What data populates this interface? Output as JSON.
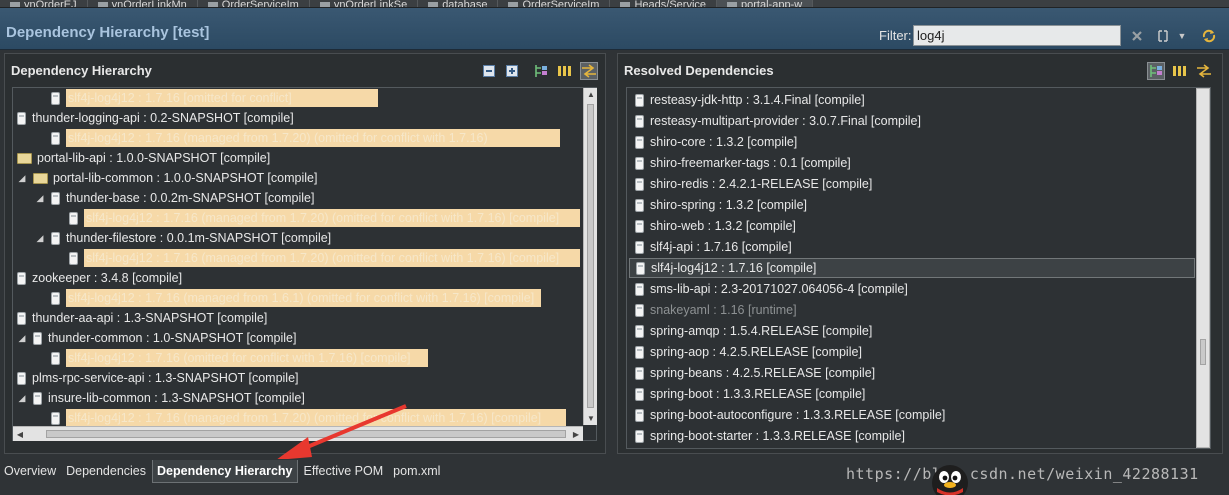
{
  "top_tabs": [
    "ynOrderEJ",
    "ynOrderLinkMn",
    "OrderServiceIm",
    "ynOrderLinkSe",
    "database",
    "OrderServiceIm",
    "Heads/Service",
    "portal-app-w"
  ],
  "header": {
    "title": "Dependency Hierarchy [test]",
    "filter_label": "Filter:",
    "filter_value": "log4j"
  },
  "left_panel": {
    "title": "Dependency Hierarchy",
    "rows": [
      {
        "indent": 1,
        "arrow": "",
        "icon": "jar",
        "label": "",
        "highlight": "slf4j-log4j12 : 1.7.16 [omitted for conflict]"
      },
      {
        "indent": 0,
        "arrow": "",
        "icon": "jar",
        "label": "thunder-logging-api : 0.2-SNAPSHOT [compile]",
        "highlight": ""
      },
      {
        "indent": 1,
        "arrow": "",
        "icon": "jar",
        "label": "",
        "highlight": "slf4j-log4j12 : 1.7.16 (managed from 1.7.20) (omitted for conflict with 1.7.16)"
      },
      {
        "indent": 0,
        "arrow": "",
        "icon": "folder",
        "label": "portal-lib-api : 1.0.0-SNAPSHOT [compile]",
        "highlight": ""
      },
      {
        "indent": 0,
        "arrow": "◢",
        "icon": "folder",
        "label": "portal-lib-common : 1.0.0-SNAPSHOT [compile]",
        "highlight": ""
      },
      {
        "indent": 1,
        "arrow": "◢",
        "icon": "jar",
        "label": "thunder-base : 0.0.2m-SNAPSHOT [compile]",
        "highlight": ""
      },
      {
        "indent": 2,
        "arrow": "",
        "icon": "jar",
        "label": "",
        "highlight": "slf4j-log4j12 : 1.7.16 (managed from 1.7.20) (omitted for conflict with 1.7.16) [compile]"
      },
      {
        "indent": 1,
        "arrow": "◢",
        "icon": "jar",
        "label": "thunder-filestore : 0.0.1m-SNAPSHOT [compile]",
        "highlight": ""
      },
      {
        "indent": 2,
        "arrow": "",
        "icon": "jar",
        "label": "",
        "highlight": "slf4j-log4j12 : 1.7.16 (managed from 1.7.20) (omitted for conflict with 1.7.16) [compile]"
      },
      {
        "indent": 0,
        "arrow": "",
        "icon": "jar",
        "label": "zookeeper : 3.4.8 [compile]",
        "highlight": ""
      },
      {
        "indent": 1,
        "arrow": "",
        "icon": "jar",
        "label": "",
        "highlight": "slf4j-log4j12 : 1.7.16 (managed from 1.6.1) (omitted for conflict with 1.7.16) [compile]"
      },
      {
        "indent": 0,
        "arrow": "",
        "icon": "jar",
        "label": "thunder-aa-api : 1.3-SNAPSHOT [compile]",
        "highlight": ""
      },
      {
        "indent": 0,
        "arrow": "◢",
        "icon": "jar",
        "label": "thunder-common : 1.0-SNAPSHOT [compile]",
        "highlight": ""
      },
      {
        "indent": 1,
        "arrow": "",
        "icon": "jar",
        "label": "",
        "highlight": "slf4j-log4j12 : 1.7.16 (omitted for conflict with 1.7.16) [compile]"
      },
      {
        "indent": 0,
        "arrow": "",
        "icon": "jar",
        "label": "plms-rpc-service-api : 1.3-SNAPSHOT [compile]",
        "highlight": ""
      },
      {
        "indent": 0,
        "arrow": "◢",
        "icon": "jar",
        "label": "insure-lib-common : 1.3-SNAPSHOT [compile]",
        "highlight": ""
      },
      {
        "indent": 1,
        "arrow": "",
        "icon": "jar",
        "label": "",
        "highlight": "slf4j-log4j12 : 1.7.16 (managed from 1.7.20) (omitted for conflict with 1.7.16) [compile]"
      }
    ]
  },
  "right_panel": {
    "title": "Resolved Dependencies",
    "rows": [
      "resteasy-jdk-http : 3.1.4.Final [compile]",
      "resteasy-multipart-provider : 3.0.7.Final [compile]",
      "shiro-core : 1.3.2 [compile]",
      "shiro-freemarker-tags : 0.1 [compile]",
      "shiro-redis : 2.4.2.1-RELEASE [compile]",
      "shiro-spring : 1.3.2 [compile]",
      "shiro-web : 1.3.2 [compile]",
      "slf4j-api : 1.7.16 [compile]",
      "slf4j-log4j12 : 1.7.16 [compile]",
      "sms-lib-api : 2.3-20171027.064056-4 [compile]",
      "snakeyaml : 1.16 [runtime]",
      "spring-amqp : 1.5.4.RELEASE [compile]",
      "spring-aop : 4.2.5.RELEASE [compile]",
      "spring-beans : 4.2.5.RELEASE [compile]",
      "spring-boot : 1.3.3.RELEASE [compile]",
      "spring-boot-autoconfigure : 1.3.3.RELEASE [compile]",
      "spring-boot-starter : 1.3.3.RELEASE [compile]"
    ],
    "selected_index": 8,
    "dim_index": 10
  },
  "bottom_tabs": [
    "Overview",
    "Dependencies",
    "Dependency Hierarchy",
    "Effective POM",
    "pom.xml"
  ],
  "active_bottom_tab": 2,
  "watermark": "https://blog.csdn.net/weixin_42288131",
  "colors": {
    "header_bg": "#2c4a63",
    "title_blue": "#a9c4de",
    "highlight": "#f6d9a8",
    "panel_bg": "#2d3134",
    "annotation_arrow": "#e8382f"
  }
}
